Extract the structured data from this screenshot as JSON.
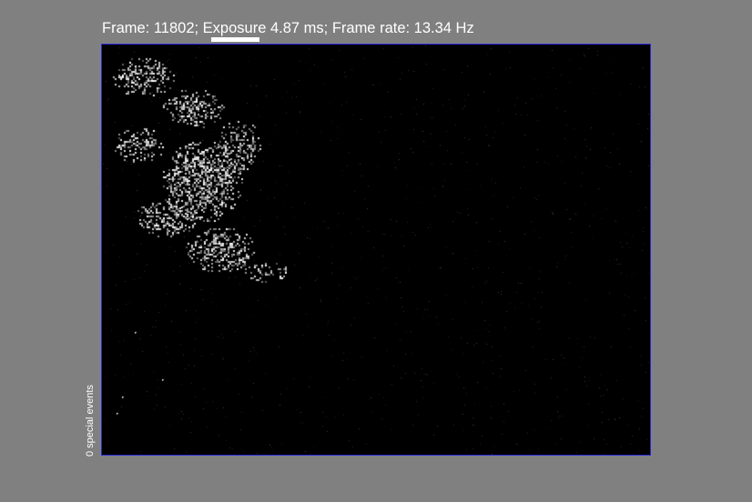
{
  "status": {
    "text": "Frame: 11802; Exposure 4.87 ms; Frame rate: 13.34 Hz",
    "frame_number": 11802,
    "exposure_ms": 4.87,
    "frame_rate_hz": 13.34
  },
  "side_label": "0 special events",
  "viewer": {
    "border_color": "#2a2ad8",
    "background_color": "#000000"
  },
  "colors": {
    "page_background": "#808080",
    "text": "#ffffff",
    "progress_bar": "#ffffff"
  }
}
